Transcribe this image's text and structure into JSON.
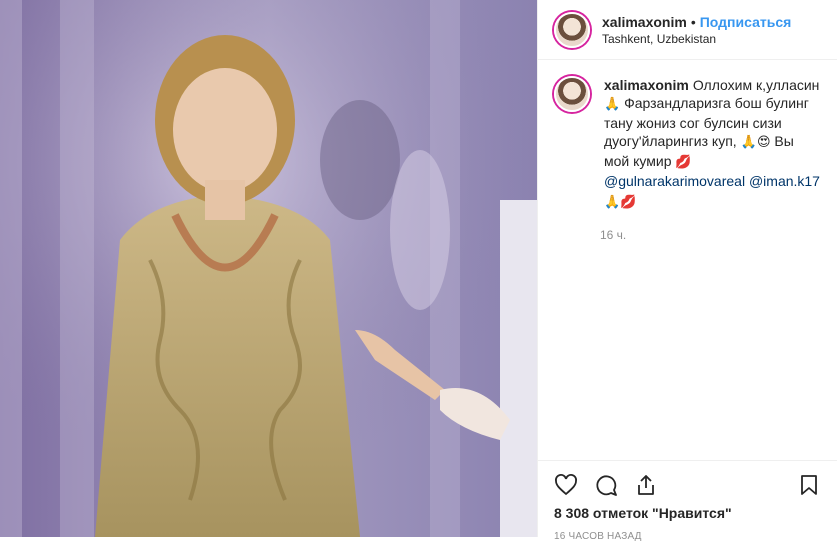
{
  "post": {
    "username": "xalimaxonim",
    "separator": "•",
    "follow_label": "Подписаться",
    "location": "Tashkent, Uzbekistan"
  },
  "caption": {
    "username": "xalimaxonim",
    "text_1": "Оллохим к,улласин",
    "emoji_1": "🙏",
    "text_2": " Фарзандларизга бош булинг тану жониз сог булсин сизи дуогу'йларингиз куп,",
    "emoji_2": " 🙏😍",
    "text_3": " Вы мой кумир",
    "emoji_3": "💋",
    "mention_1": "@gulnarakarimovareal",
    "mention_2": "@iman.k17",
    "emoji_4": " 🙏💋",
    "time": "16 ч."
  },
  "footer": {
    "likes": "8 308 отметок \"Нравится\"",
    "ago": "16 часов назад"
  },
  "icons": [
    "photo",
    "avatar",
    "heart-icon",
    "comment-icon",
    "share-icon",
    "bookmark-icon"
  ]
}
